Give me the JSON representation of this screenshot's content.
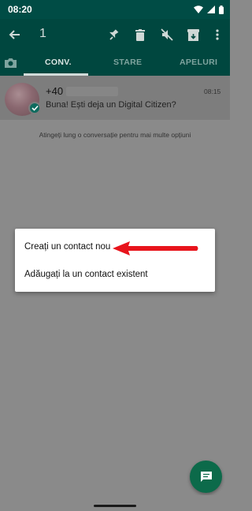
{
  "status_bar": {
    "time": "08:20"
  },
  "app_bar": {
    "selected_count": "1"
  },
  "tabs": [
    {
      "label": "CONV.",
      "active": true
    },
    {
      "label": "STARE",
      "active": false
    },
    {
      "label": "APELURI",
      "active": false
    }
  ],
  "chat": {
    "name": "+40",
    "time": "08:15",
    "preview": "Buna! Ești deja un Digital Citizen?"
  },
  "hint": "Atingeți lung o conversație pentru mai multe opțiuni",
  "context_menu": {
    "items": [
      {
        "label": "Creați un contact nou"
      },
      {
        "label": "Adăugați la un contact existent"
      }
    ]
  },
  "colors": {
    "app_bar": "#00473f",
    "annotation_arrow": "#e8141c",
    "fab": "#0c6a4a"
  },
  "icons": [
    "wifi-icon",
    "signal-icon",
    "battery-icon",
    "back-arrow-icon",
    "pin-icon",
    "delete-icon",
    "mute-icon",
    "archive-icon",
    "more-vert-icon",
    "camera-icon",
    "check-icon",
    "chat-icon"
  ]
}
